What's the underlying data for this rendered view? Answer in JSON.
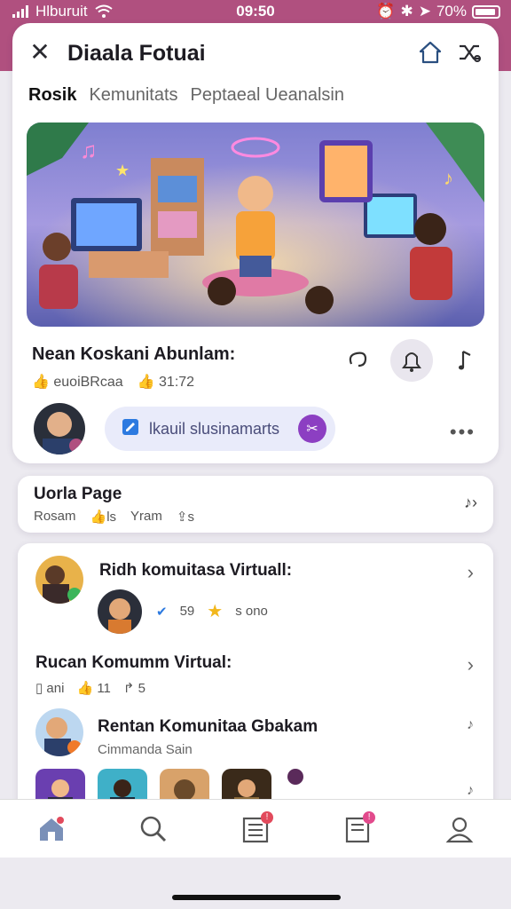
{
  "status_bar": {
    "carrier": "Hlburuit",
    "time": "09:50",
    "battery": "70%"
  },
  "header": {
    "title": "Diaala Fotuai",
    "close_icon": "close-icon",
    "home_icon": "home-outline-icon",
    "share_icon": "shuffle-icon"
  },
  "tabs": [
    "Rosik",
    "Kemunitats",
    "Peptaeal Ueanalsin"
  ],
  "post": {
    "title": "Nean Koskani Abunlam:",
    "stat_a": "euoiBRcaa",
    "stat_b": "31:72"
  },
  "pill": {
    "label": "lkauil slusinamarts"
  },
  "more_label": "•••",
  "page_card": {
    "title": "Uorla Page",
    "meta": [
      "Rosam",
      "ls",
      "Yram",
      "s"
    ]
  },
  "list": [
    {
      "title": "Ridh komuitasa Virtuall:",
      "meta": [
        "59",
        "s ono"
      ]
    },
    {
      "title": "Rucan Komumm Virtual:",
      "meta": [
        "ani",
        "11",
        "5"
      ]
    },
    {
      "title": "Rentan Komunitaa Gbakam",
      "sub": "Cimmanda Sain"
    }
  ],
  "colors": {
    "status_bar": "#b0507f",
    "accent_purple": "#8c3fc2",
    "badge_red": "#e24a5c"
  }
}
